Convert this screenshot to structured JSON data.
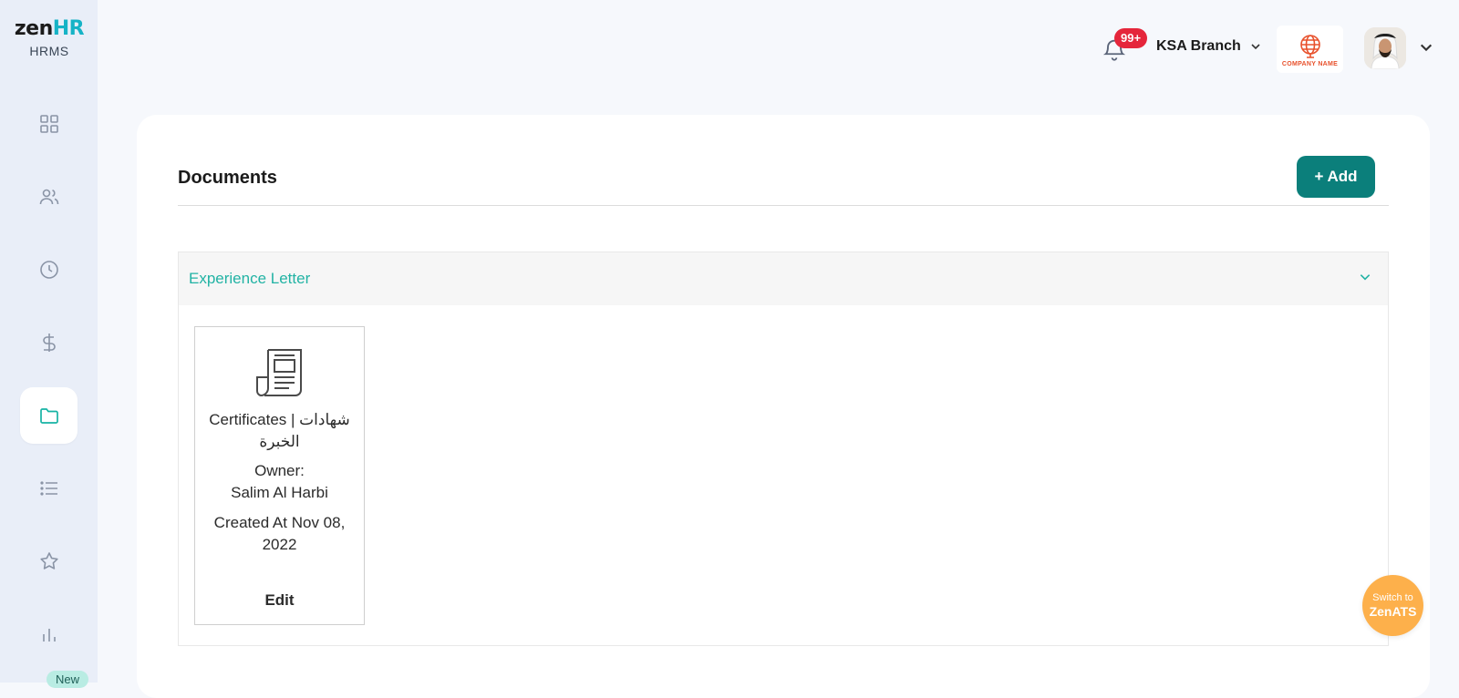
{
  "app": {
    "logo_main_prefix": "zen",
    "logo_main_suffix": "HR",
    "logo_sub": "HRMS"
  },
  "sidebar": {
    "items": [
      {
        "icon": "dashboard-icon",
        "active": false
      },
      {
        "icon": "users-icon",
        "active": false
      },
      {
        "icon": "clock-icon",
        "active": false
      },
      {
        "icon": "dollar-icon",
        "active": false
      },
      {
        "icon": "folder-icon",
        "active": true
      },
      {
        "icon": "list-icon",
        "active": false
      },
      {
        "icon": "star-icon",
        "active": false
      },
      {
        "icon": "bar-chart-icon",
        "active": false
      }
    ],
    "new_badge": "New"
  },
  "header": {
    "notifications_count": "99+",
    "branch": "KSA Branch",
    "company_logo_text": "COMPANY NAME"
  },
  "documents": {
    "title": "Documents",
    "add_label": "+ Add",
    "category": "Experience Letter",
    "items": [
      {
        "name": "Certificates | شهادات الخبرة",
        "owner_label": "Owner:",
        "owner": "Salim Al Harbi",
        "created": "Created At Nov 08, 2022",
        "edit_label": "Edit"
      }
    ]
  },
  "switch": {
    "line1": "Switch to",
    "line2": "ZenATS"
  },
  "colors": {
    "accent": "#0b7f7b",
    "accent_text": "#22b3a4",
    "badge_red": "#e5263b",
    "fab_orange": "#fdb04b",
    "sidebar_bg": "#e9eef8"
  }
}
